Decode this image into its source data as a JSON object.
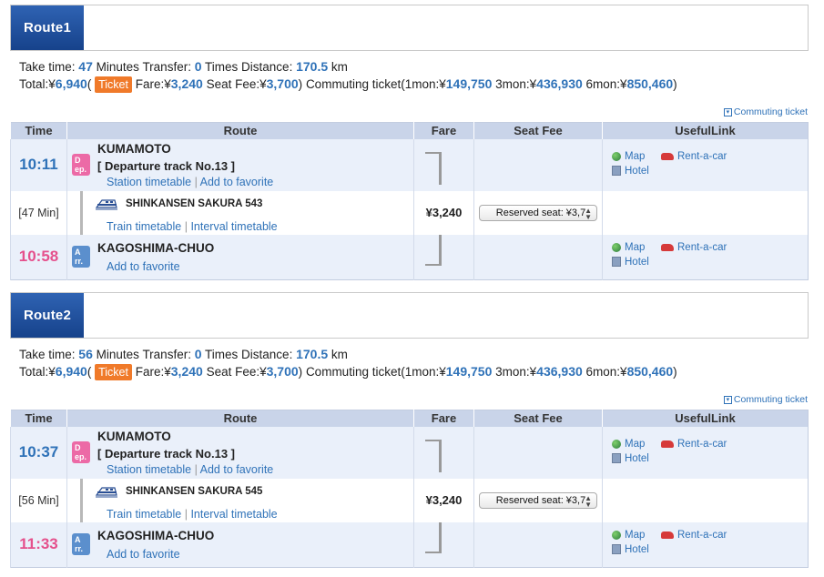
{
  "commuting_ticket_link": "Commuting ticket",
  "columns": {
    "time": "Time",
    "route": "Route",
    "fare": "Fare",
    "seat_fee": "Seat Fee",
    "useful_link": "UsefulLink"
  },
  "links": {
    "station_timetable": "Station timetable",
    "add_favorite": "Add to favorite",
    "train_timetable": "Train timetable",
    "interval_timetable": "Interval timetable",
    "map": "Map",
    "rent_a_car": "Rent-a-car",
    "hotel": "Hotel",
    "separator": "|"
  },
  "badges": {
    "dep": "D\nep.",
    "arr": "A\nrr."
  },
  "labels": {
    "take_time": "Take time:",
    "minutes": "Minutes",
    "transfer": "Transfer:",
    "times": "Times",
    "distance": "Distance:",
    "km": "km",
    "total": "Total:¥",
    "ticket": "Ticket",
    "fare": "Fare:¥",
    "seat_fee": "Seat Fee:¥",
    "commuting": "Commuting ticket(1mon:¥",
    "mon3": "3mon:¥",
    "mon6": "6mon:¥",
    "open_paren": "(",
    "close_paren": ")"
  },
  "routes": [
    {
      "title": "Route1",
      "take_time": "47",
      "transfer": "0",
      "distance": "170.5",
      "total": "6,940",
      "fare": "3,240",
      "seat_fee": "3,700",
      "mon1": "149,750",
      "mon3": "436,930",
      "mon6": "850,460",
      "dep_time": "10:11",
      "dep_station": "KUMAMOTO",
      "dep_track": "[ Departure track No.13 ]",
      "duration": "[47 Min]",
      "train": "SHINKANSEN SAKURA 543",
      "leg_fare": "¥3,240",
      "seat_option": "Reserved seat: ¥3,7",
      "arr_time": "10:58",
      "arr_station": "KAGOSHIMA-CHUO"
    },
    {
      "title": "Route2",
      "take_time": "56",
      "transfer": "0",
      "distance": "170.5",
      "total": "6,940",
      "fare": "3,240",
      "seat_fee": "3,700",
      "mon1": "149,750",
      "mon3": "436,930",
      "mon6": "850,460",
      "dep_time": "10:37",
      "dep_station": "KUMAMOTO",
      "dep_track": "[ Departure track No.13 ]",
      "duration": "[56 Min]",
      "train": "SHINKANSEN SAKURA 545",
      "leg_fare": "¥3,240",
      "seat_option": "Reserved seat: ¥3,7",
      "arr_time": "11:33",
      "arr_station": "KAGOSHIMA-CHUO"
    }
  ],
  "colors": {
    "accent_blue": "#2f72b8",
    "arrival_pink": "#e5508c",
    "ticket_orange": "#f07a2a",
    "header_blue": "#16428b"
  }
}
